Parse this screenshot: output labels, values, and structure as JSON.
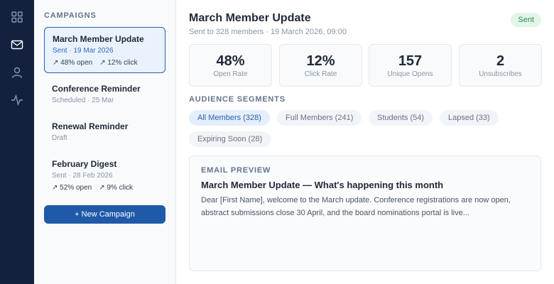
{
  "nav": {
    "items": [
      {
        "icon": "grid-icon"
      },
      {
        "icon": "mail-icon",
        "active": true
      },
      {
        "icon": "user-icon"
      },
      {
        "icon": "activity-icon"
      }
    ]
  },
  "campaigns": {
    "title": "CAMPAIGNS",
    "items": [
      {
        "name": "March Member Update",
        "meta": "Sent · 19 Mar 2026",
        "open": "↗ 48% open",
        "click": "↗ 12% click"
      },
      {
        "name": "Conference Reminder",
        "meta": "Scheduled · 25 Mar"
      },
      {
        "name": "Renewal Reminder",
        "meta": "Draft"
      },
      {
        "name": "February Digest",
        "meta": "Sent · 28 Feb 2026",
        "open": "↗ 52% open",
        "click": "↗ 9% click"
      }
    ],
    "new_label": "+ New Campaign"
  },
  "main": {
    "title": "March Member Update",
    "subtitle": "Sent to 328 members · 19 March 2026, 09:00",
    "status": "Sent",
    "stats": [
      {
        "value": "48%",
        "label": "Open Rate"
      },
      {
        "value": "12%",
        "label": "Click Rate"
      },
      {
        "value": "157",
        "label": "Unique Opens"
      },
      {
        "value": "2",
        "label": "Unsubscribes"
      }
    ],
    "segments_title": "AUDIENCE SEGMENTS",
    "segments": [
      {
        "label": "All Members (328)",
        "active": true
      },
      {
        "label": "Full Members (241)"
      },
      {
        "label": "Students (54)"
      },
      {
        "label": "Lapsed (33)"
      },
      {
        "label": "Expiring Soon (28)"
      }
    ],
    "preview": {
      "label": "EMAIL PREVIEW",
      "subject": "March Member Update — What's happening this month",
      "body": "Dear [First Name], welcome to the March update. Conference registrations are now open, abstract submissions close 30 April, and the board nominations portal is live..."
    }
  },
  "colors": {
    "rail": "#13213f",
    "accent": "#1e5aa8",
    "sent_badge_bg": "#e3f5e8",
    "sent_badge_text": "#2f8a50"
  }
}
